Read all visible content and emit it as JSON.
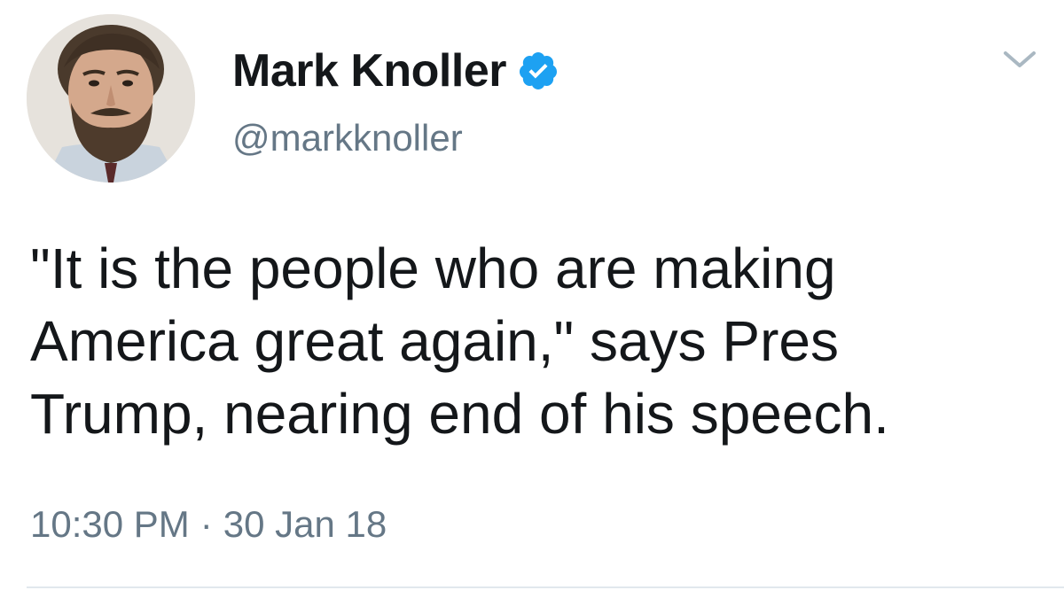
{
  "author": {
    "display_name": "Mark Knoller",
    "handle": "@markknoller",
    "verified": true
  },
  "tweet": {
    "text": "\"It is the people who are making\nAmerica great again,\" says Pres\nTrump, nearing end of his speech.",
    "time": "10:30 PM",
    "separator": "·",
    "date": "30 Jan 18"
  },
  "icons": {
    "verified": "verified-badge-icon",
    "menu": "chevron-down-icon"
  },
  "colors": {
    "text": "#14171a",
    "secondary": "#657786",
    "verified": "#1da1f2",
    "divider": "#e1e8ed"
  }
}
